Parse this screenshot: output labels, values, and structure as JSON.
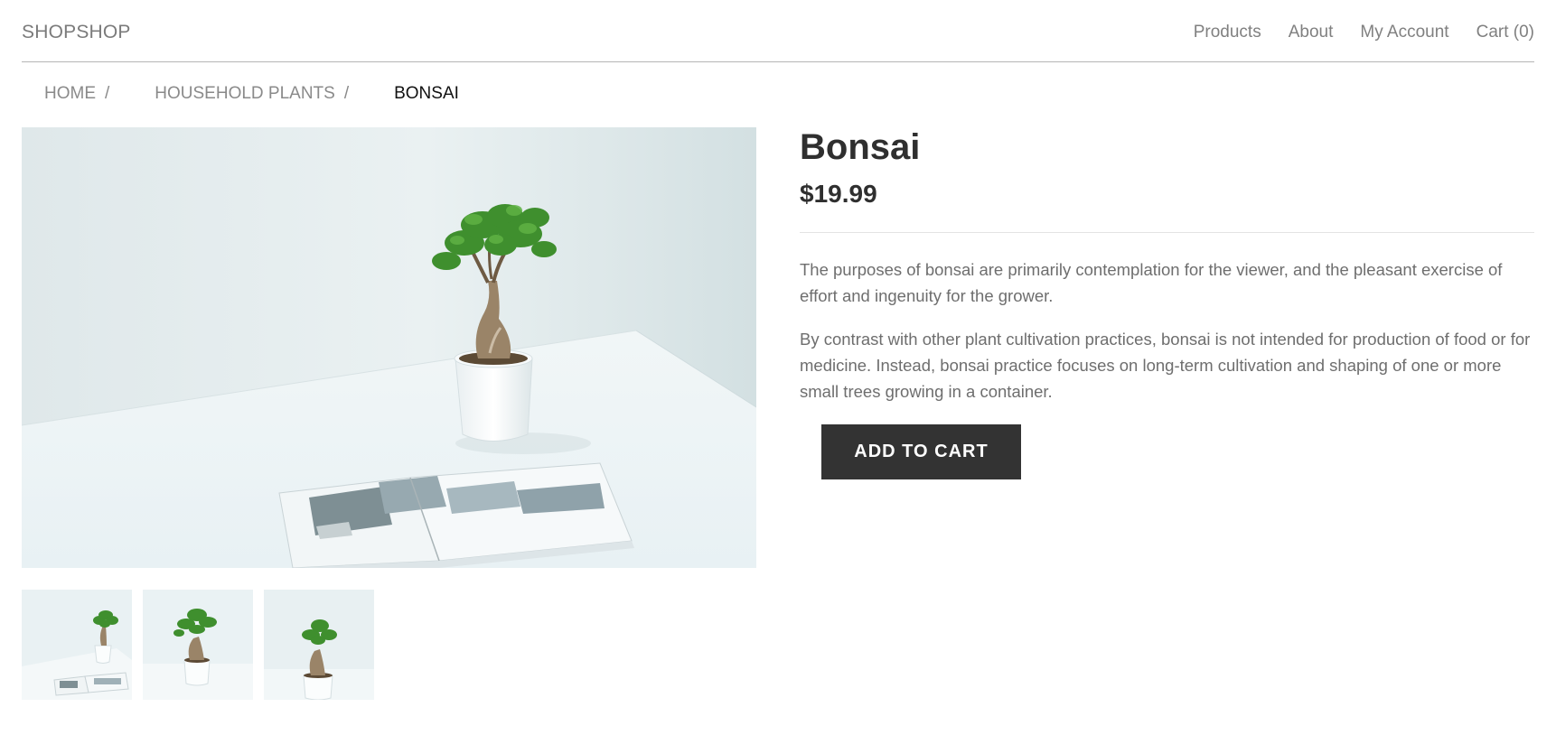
{
  "header": {
    "logo": "SHOPSHOP",
    "nav": [
      {
        "label": "Products"
      },
      {
        "label": "About"
      },
      {
        "label": "My Account"
      },
      {
        "label": "Cart (0)"
      }
    ]
  },
  "breadcrumb": {
    "items": [
      {
        "label": "HOME",
        "separator": "/"
      },
      {
        "label": "HOUSEHOLD PLANTS",
        "separator": "/"
      }
    ],
    "current": "BONSAI"
  },
  "product": {
    "title": "Bonsai",
    "price": "$19.99",
    "description": [
      "The purposes of bonsai are primarily contemplation for the viewer, and the pleasant exercise of effort and ingenuity for the grower.",
      "By contrast with other plant cultivation practices, bonsai is not intended for production of food or for medicine. Instead, bonsai practice focuses on long-term cultivation and shaping of one or more small trees growing in a container."
    ],
    "add_to_cart_label": "ADD TO CART"
  },
  "colors": {
    "text_dark": "#333333",
    "text_muted": "#6e6e6e",
    "button_bg": "#333333",
    "button_text": "#ffffff",
    "leaf_green": "#3f8f2e",
    "photo_bg": "#e6eef0"
  }
}
